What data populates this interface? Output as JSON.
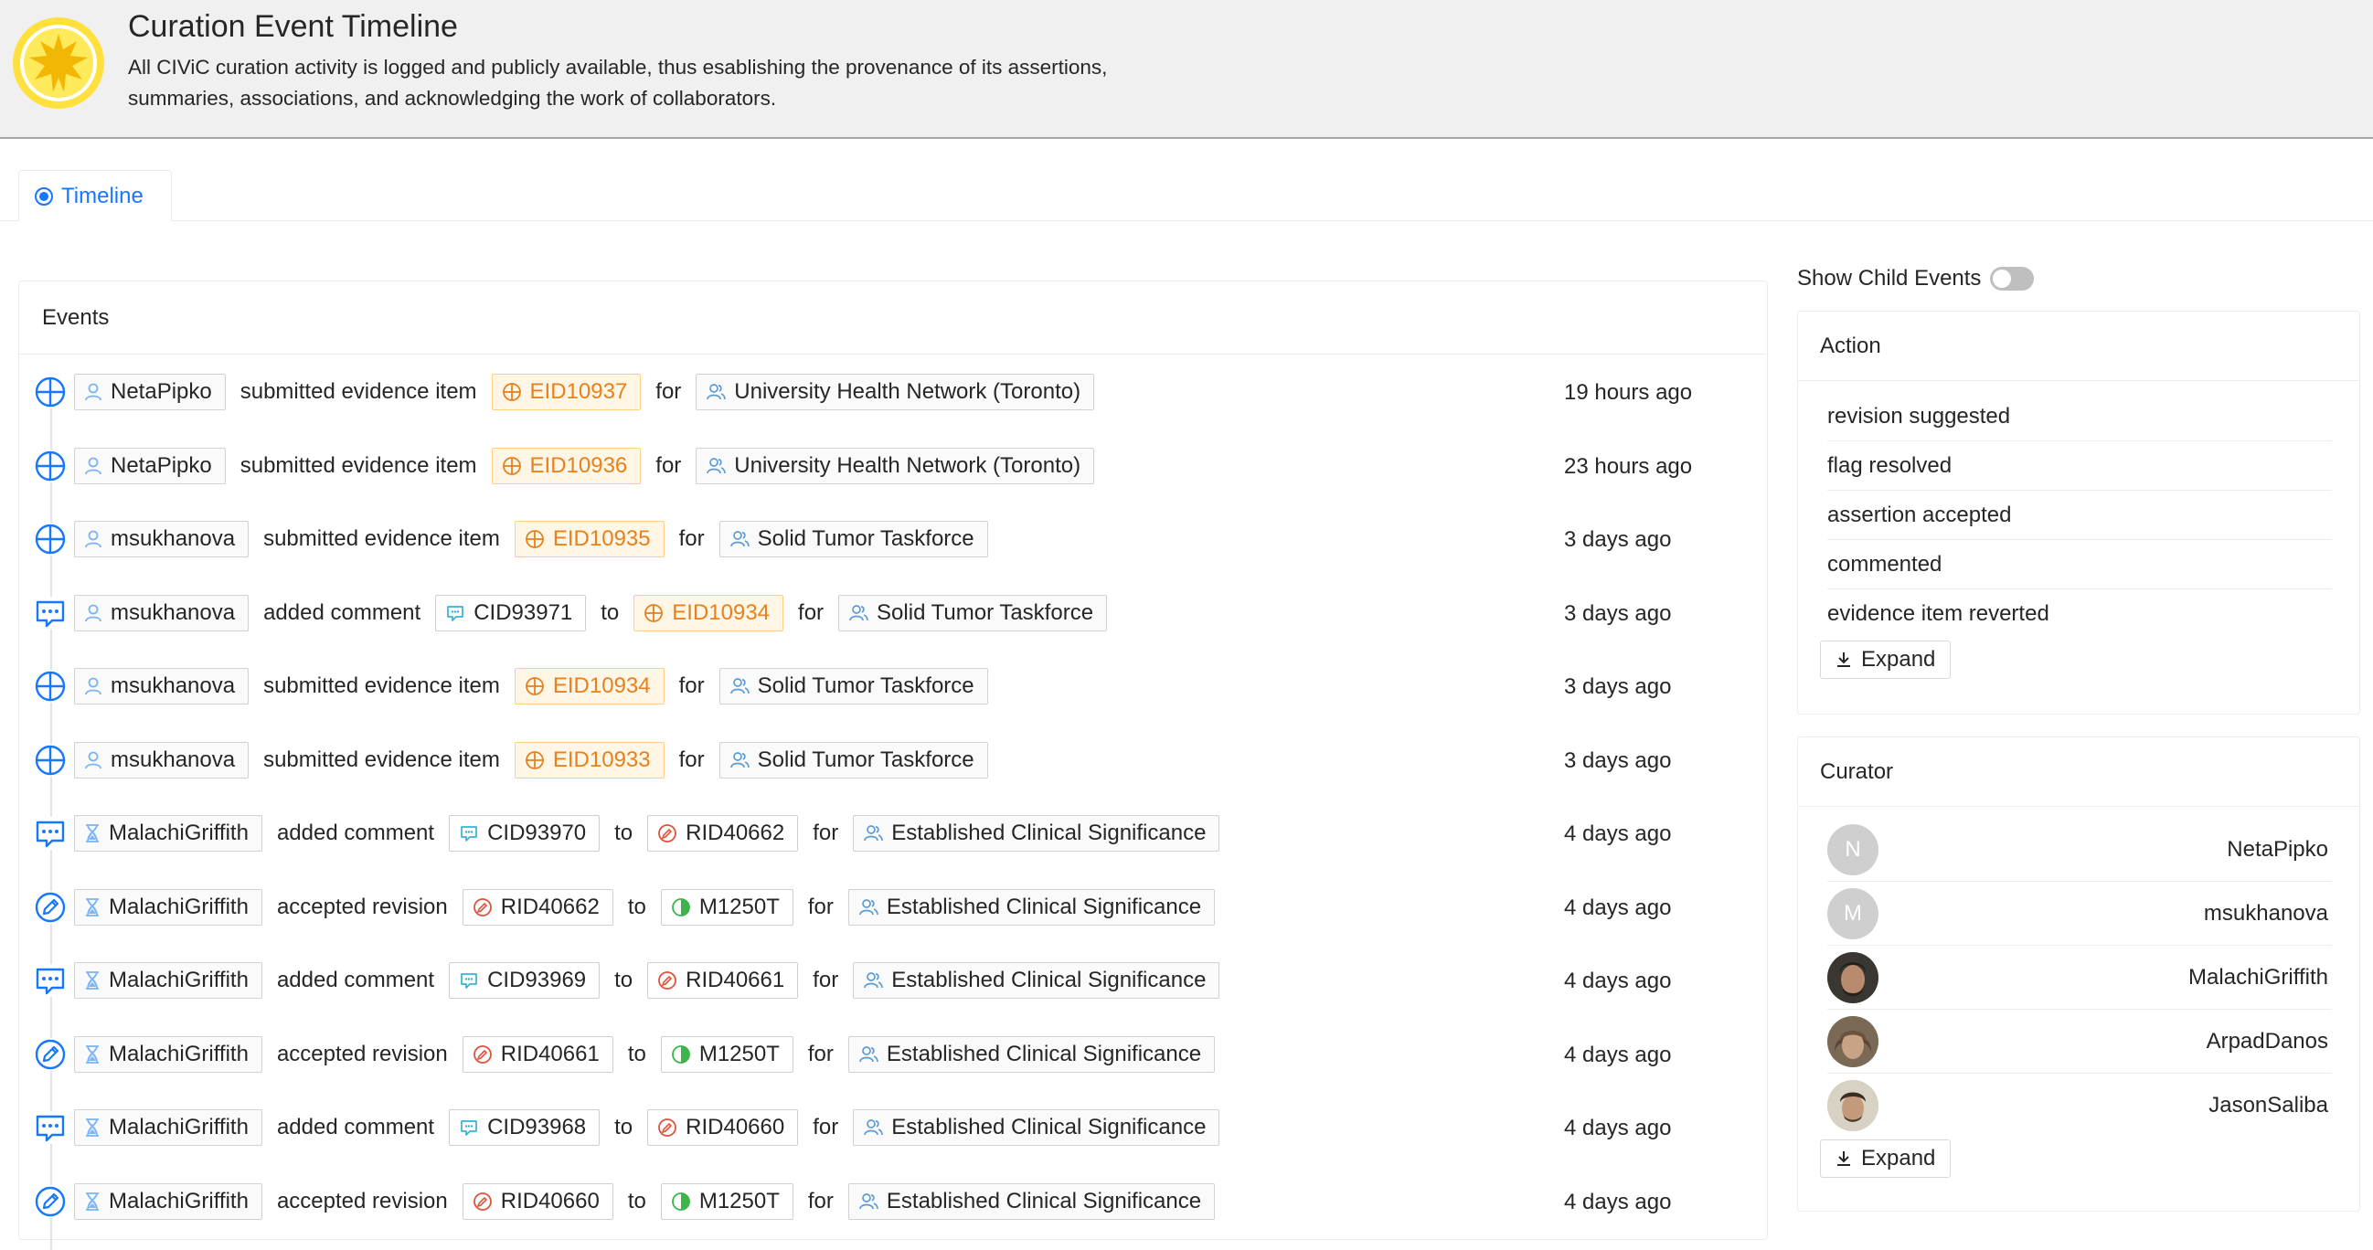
{
  "header": {
    "title": "Curation Event Timeline",
    "description": "All CIViC curation activity is logged and publicly available, thus esablishing the provenance of its assertions, summaries, associations, and acknowledging the work of collaborators."
  },
  "tabs": [
    {
      "label": "Timeline",
      "active": true
    }
  ],
  "events_card": {
    "title": "Events",
    "rows": [
      {
        "kind": "submitted",
        "user": "NetaPipko",
        "user_type": "user",
        "verb": "submitted evidence item",
        "target": "EID10937",
        "target_type": "evidence",
        "for": "for",
        "org": "University Health Network (Toronto)",
        "time": "19 hours ago"
      },
      {
        "kind": "submitted",
        "user": "NetaPipko",
        "user_type": "user",
        "verb": "submitted evidence item",
        "target": "EID10936",
        "target_type": "evidence",
        "for": "for",
        "org": "University Health Network (Toronto)",
        "time": "23 hours ago"
      },
      {
        "kind": "submitted",
        "user": "msukhanova",
        "user_type": "user",
        "verb": "submitted evidence item",
        "target": "EID10935",
        "target_type": "evidence",
        "for": "for",
        "org": "Solid Tumor Taskforce",
        "time": "3 days ago"
      },
      {
        "kind": "comment",
        "user": "msukhanova",
        "user_type": "user",
        "verb": "added comment",
        "comment": "CID93971",
        "to": "to",
        "target": "EID10934",
        "target_type": "evidence",
        "for": "for",
        "org": "Solid Tumor Taskforce",
        "time": "3 days ago"
      },
      {
        "kind": "submitted",
        "user": "msukhanova",
        "user_type": "user",
        "verb": "submitted evidence item",
        "target": "EID10934",
        "target_type": "evidence",
        "for": "for",
        "org": "Solid Tumor Taskforce",
        "time": "3 days ago"
      },
      {
        "kind": "submitted",
        "user": "msukhanova",
        "user_type": "user",
        "verb": "submitted evidence item",
        "target": "EID10933",
        "target_type": "evidence",
        "for": "for",
        "org": "Solid Tumor Taskforce",
        "time": "3 days ago"
      },
      {
        "kind": "comment",
        "user": "MalachiGriffith",
        "user_type": "editor",
        "verb": "added comment",
        "comment": "CID93970",
        "to": "to",
        "target": "RID40662",
        "target_type": "revision",
        "for": "for",
        "org": "Established Clinical Significance",
        "time": "4 days ago"
      },
      {
        "kind": "revision",
        "user": "MalachiGriffith",
        "user_type": "editor",
        "verb": "accepted revision",
        "comment": "RID40662",
        "comment_type": "revision",
        "to": "to",
        "target": "M1250T",
        "target_type": "variant",
        "for": "for",
        "org": "Established Clinical Significance",
        "time": "4 days ago"
      },
      {
        "kind": "comment",
        "user": "MalachiGriffith",
        "user_type": "editor",
        "verb": "added comment",
        "comment": "CID93969",
        "to": "to",
        "target": "RID40661",
        "target_type": "revision",
        "for": "for",
        "org": "Established Clinical Significance",
        "time": "4 days ago"
      },
      {
        "kind": "revision",
        "user": "MalachiGriffith",
        "user_type": "editor",
        "verb": "accepted revision",
        "comment": "RID40661",
        "comment_type": "revision",
        "to": "to",
        "target": "M1250T",
        "target_type": "variant",
        "for": "for",
        "org": "Established Clinical Significance",
        "time": "4 days ago"
      },
      {
        "kind": "comment",
        "user": "MalachiGriffith",
        "user_type": "editor",
        "verb": "added comment",
        "comment": "CID93968",
        "to": "to",
        "target": "RID40660",
        "target_type": "revision",
        "for": "for",
        "org": "Established Clinical Significance",
        "time": "4 days ago"
      },
      {
        "kind": "revision",
        "user": "MalachiGriffith",
        "user_type": "editor",
        "verb": "accepted revision",
        "comment": "RID40660",
        "comment_type": "revision",
        "to": "to",
        "target": "M1250T",
        "target_type": "variant",
        "for": "for",
        "org": "Established Clinical Significance",
        "time": "4 days ago"
      }
    ]
  },
  "sidebar": {
    "show_child_events": {
      "label": "Show Child Events",
      "checked": false
    },
    "action": {
      "title": "Action",
      "items": [
        "revision suggested",
        "flag resolved",
        "assertion accepted",
        "commented",
        "evidence item reverted"
      ],
      "expand_label": "Expand"
    },
    "curator": {
      "title": "Curator",
      "items": [
        {
          "name": "NetaPipko",
          "initial": "N",
          "avatar": "initial"
        },
        {
          "name": "msukhanova",
          "initial": "M",
          "avatar": "initial"
        },
        {
          "name": "MalachiGriffith",
          "initial": "",
          "avatar": "photo"
        },
        {
          "name": "ArpadDanos",
          "initial": "",
          "avatar": "photo"
        },
        {
          "name": "JasonSaliba",
          "initial": "",
          "avatar": "photo"
        }
      ],
      "expand_label": "Expand"
    }
  },
  "colors": {
    "accent": "#1677ff",
    "evidence_orange": "#e8801c",
    "evidence_bg": "#fff6e6",
    "revision_red": "#e0533b",
    "variant_green": "#3bb54a",
    "logo_yellow": "#ffe03d"
  },
  "icons": {
    "logo": "civic-sun-icon",
    "tab": "timeline-radio-icon",
    "submitted": "evidence-crosshair-icon",
    "comment": "comment-bubble-icon",
    "revision": "pencil-edit-icon",
    "user": "user-icon",
    "editor": "hourglass-user-icon",
    "org": "group-icon",
    "expand": "download-arrow-icon"
  }
}
